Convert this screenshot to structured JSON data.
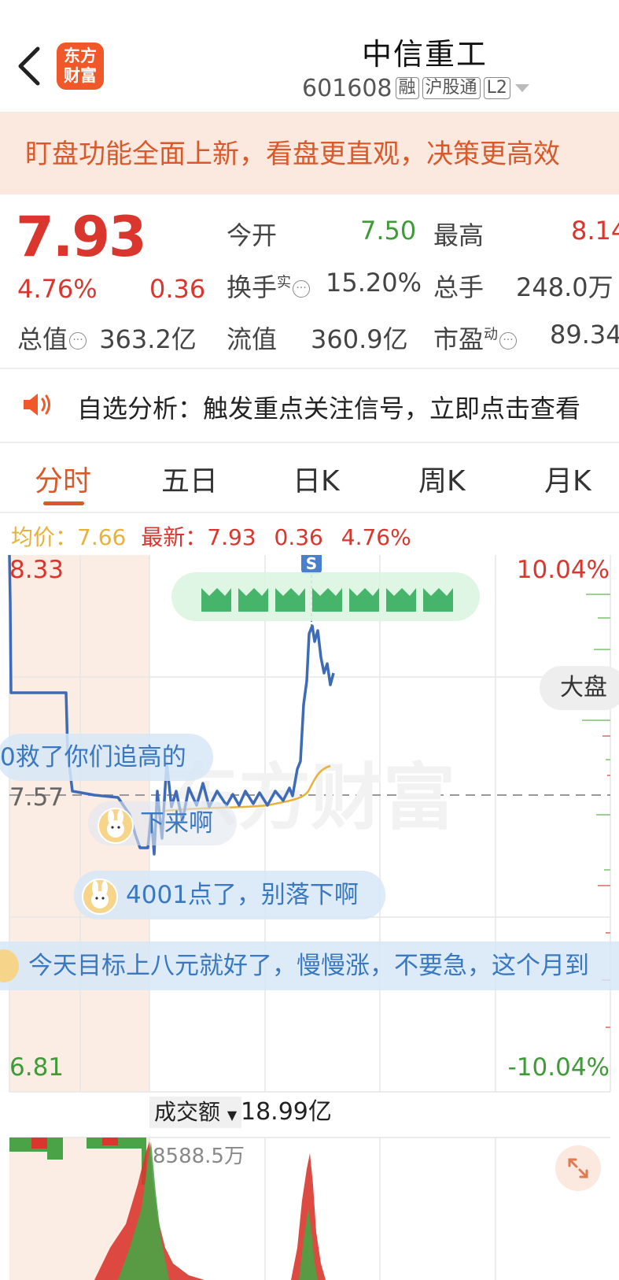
{
  "header": {
    "logo_line1": "东方",
    "logo_line2": "财富",
    "title": "中信重工",
    "code": "601608",
    "tags": [
      "融",
      "沪股通",
      "L2"
    ]
  },
  "banner": {
    "text": "盯盘功能全面上新，看盘更直观，决策更高效"
  },
  "quote": {
    "price": "7.93",
    "change_pct": "4.76%",
    "change": "0.36",
    "open_label": "今开",
    "open_value": "7.50",
    "high_label": "最高",
    "high_value": "8.14",
    "turnover_label": "换手",
    "turnover_sup": "实",
    "turnover_value": "15.20%",
    "volume_label": "总手",
    "volume_value": "248.0万",
    "mktcap_label": "总值",
    "mktcap_value": "363.2亿",
    "float_label": "流值",
    "float_value": "360.9亿",
    "pe_label": "市盈",
    "pe_sup": "动",
    "pe_value": "89.34"
  },
  "analysis": {
    "text": "自选分析：触发重点关注信号，立即点击查看"
  },
  "tabs": [
    "分时",
    "五日",
    "日K",
    "周K",
    "月K"
  ],
  "legend": {
    "avg_label": "均价：",
    "avg_value": "7.66",
    "latest_label": "最新：",
    "latest_value": "7.93",
    "latest_change": "0.36",
    "latest_pct": "4.76%"
  },
  "chart": {
    "y_max": "8.33",
    "y_mid": "7.57",
    "y_min": "6.81",
    "pct_max": "10.04%",
    "pct_min": "-10.04%",
    "signal": "S",
    "dapan": "大盘",
    "volume_select": "成交额",
    "volume_total": "18.99亿",
    "volume_max": "8588.5万",
    "watermark": "东方财富"
  },
  "comments": [
    "0救了你们追高的",
    "下来啊",
    "4001点了，别落下啊",
    "今天目标上八元就好了，慢慢涨，不要急，这个月到"
  ],
  "colors": {
    "up": "#d9362e",
    "down": "#3f9b38",
    "accent": "#d9592a",
    "price_line": "#3e6bb8",
    "avg_line": "#e8b13a"
  }
}
